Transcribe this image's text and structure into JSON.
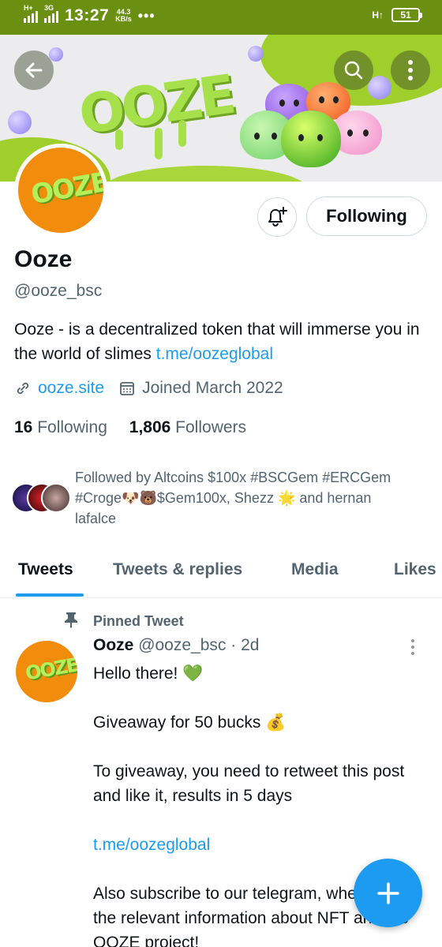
{
  "status_bar": {
    "network_1": "H+",
    "network_2": "3G",
    "time": "13:27",
    "speed_value": "44.3",
    "speed_unit": "KB/s",
    "more": "•••",
    "right_network": "H↑",
    "battery": "51"
  },
  "header": {
    "back_icon": "arrow-left-icon",
    "search_icon": "search-icon",
    "more_icon": "more-vertical-icon",
    "banner_logo_text": "OOZE"
  },
  "profile": {
    "avatar_text": "OOZE",
    "notify_icon": "bell-plus-icon",
    "following_button": "Following",
    "name": "Ooze",
    "handle": "@ooze_bsc",
    "bio_text": "Ooze - is a decentralized token that will immerse you in the world of slimes ",
    "bio_link": "t.me/oozeglobal",
    "website": "ooze.site",
    "joined": "Joined March 2022",
    "following_count": "16",
    "following_label": "Following",
    "followers_count": "1,806",
    "followers_label": "Followers",
    "followed_by": "Followed by Altcoins $100x #BSCGem #ERCGem #Croge🐶🐻$Gem100x, Shezz 🌟 and hernan lafalce"
  },
  "tabs": [
    {
      "label": "Tweets",
      "active": true
    },
    {
      "label": "Tweets & replies",
      "active": false
    },
    {
      "label": "Media",
      "active": false
    },
    {
      "label": "Likes",
      "active": false
    }
  ],
  "tweet": {
    "pinned_label": "Pinned Tweet",
    "author": "Ooze",
    "handle_time": "@ooze_bsc · 2d",
    "line1": "Hello there! 💚",
    "line2": "Giveaway for 50 bucks 💰",
    "line3": "To giveaway, you need to retweet this post and like it, results in 5 days",
    "link": "t.me/oozeglobal",
    "line4": "Also subscribe to our telegram, where all the relevant information about NFT and the OOZE project!"
  },
  "fab": {
    "icon": "plus-icon"
  },
  "colors": {
    "status_bar": "#6b8f10",
    "accent": "#1d9bf0",
    "avatar_bg": "#f28c0c",
    "slime_green": "#a6e04a"
  }
}
